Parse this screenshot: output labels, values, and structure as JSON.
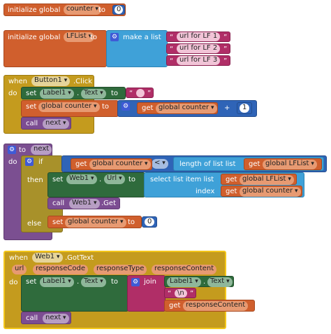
{
  "block1": {
    "kw": "initialize global",
    "var": "counter",
    "to": "to",
    "value": "0"
  },
  "block2": {
    "kw": "initialize global",
    "var": "LFList",
    "to": "to",
    "make": "make a list",
    "items": [
      "url for LF 1",
      "url for LF 2",
      "url for LF 3"
    ]
  },
  "block3": {
    "when": "when",
    "comp": "Button1",
    "event": ".Click",
    "do": "do",
    "set": "set",
    "label_comp": "Label1",
    "dot": ".",
    "prop": "Text",
    "to": "to",
    "empty_str": "",
    "set2": "set",
    "gvar": "global counter",
    "to2": "to",
    "get": "get",
    "gvar2": "global counter",
    "plus": "+",
    "one": "1",
    "call": "call",
    "next": "next"
  },
  "block4": {
    "to": "to",
    "name": "next",
    "do": "do",
    "if": "if",
    "get": "get",
    "gvar": "global counter",
    "lt": "<",
    "length": "length of list  list",
    "get2": "get",
    "glist": "global LFList",
    "then": "then",
    "set": "set",
    "web": "Web1",
    "dot": ".",
    "url": "Url",
    "to2": "to",
    "select": "select list item  list",
    "get3": "get",
    "glist2": "global LFList",
    "index": "index",
    "get4": "get",
    "gvar2": "global counter",
    "call": "call",
    "web2": "Web1",
    "dotget": ".Get",
    "else": "else",
    "set2": "set",
    "gvar3": "global counter",
    "to3": "to",
    "zero": "0"
  },
  "block5": {
    "when": "when",
    "comp": "Web1",
    "event": ".GotText",
    "params": [
      "url",
      "responseCode",
      "responseType",
      "responseContent"
    ],
    "do": "do",
    "set": "set",
    "label_comp": "Label1",
    "dot": ".",
    "prop": "Text",
    "to": "to",
    "join": "join",
    "label2": "Label1",
    "dot2": ".",
    "prop2": "Text",
    "newline": "\\n",
    "get": "get",
    "rc": "responseContent",
    "call": "call",
    "next": "next"
  }
}
